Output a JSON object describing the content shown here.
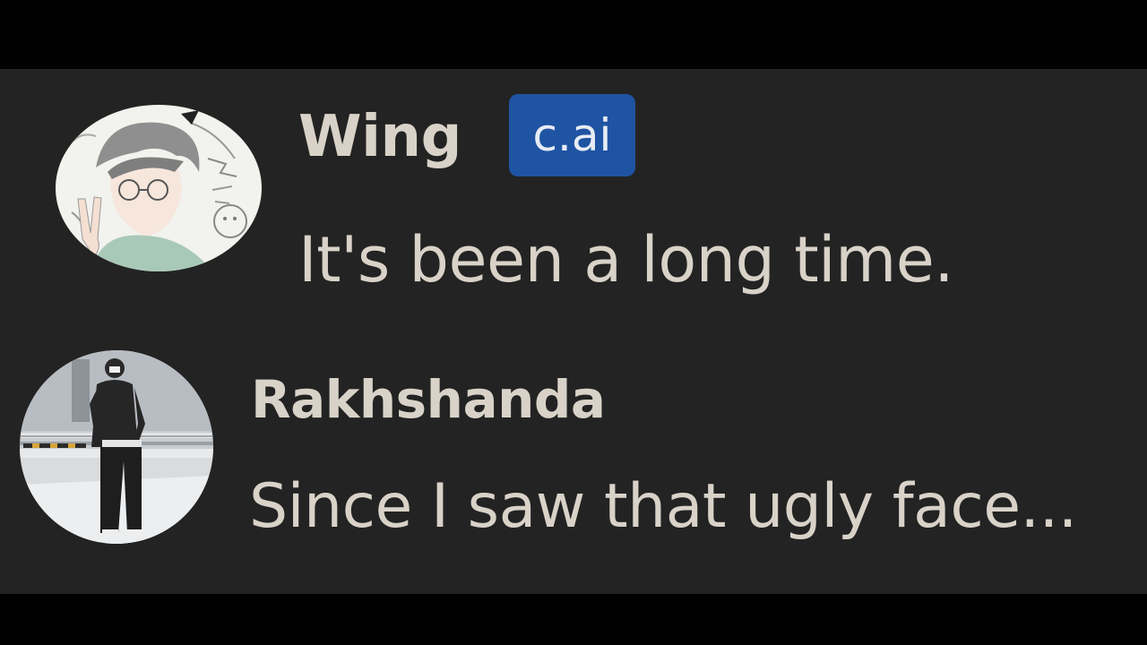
{
  "messages": [
    {
      "author": "Wing",
      "badge": "c.ai",
      "text": "It's been a long time.",
      "avatar_icon": "anime-boy-sketch-avatar"
    },
    {
      "author": "Rakhshanda",
      "text": "Since I saw that ugly face...",
      "avatar_icon": "person-photo-avatar"
    }
  ],
  "colors": {
    "background": "#232323",
    "letterbox": "#000000",
    "text": "#d8d2c8",
    "badge_bg": "#1f54a3",
    "badge_text": "#e7ecf4"
  }
}
